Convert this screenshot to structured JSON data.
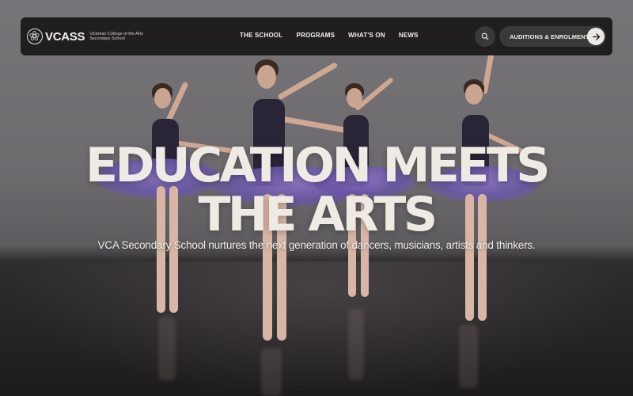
{
  "brand": {
    "name": "VCASS",
    "subtitle_line1": "Victorian College of the Arts",
    "subtitle_line2": "Secondary School"
  },
  "nav": {
    "links": [
      "THE SCHOOL",
      "PROGRAMS",
      "WHAT'S ON",
      "NEWS"
    ],
    "cta_label": "AUDITIONS & ENROLMENT",
    "search_icon": "search-icon",
    "cta_icon": "arrow-right-icon"
  },
  "hero": {
    "headline_line1": "EDUCATION MEETS",
    "headline_line2": "THE ARTS",
    "subheading": "VCA Secondary School nurtures the next generation of dancers, musicians, artists and thinkers.",
    "image": "ballet-dancers-photo"
  },
  "colors": {
    "nav_bg": "#1c1b1b",
    "text_light": "#efebe4",
    "tutu_purple": "#7a64b8"
  }
}
